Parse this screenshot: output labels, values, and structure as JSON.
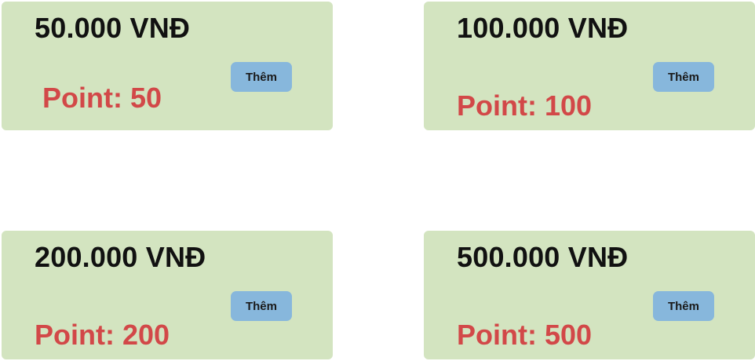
{
  "cards": [
    {
      "price": "50.000 VNĐ",
      "points": "Point: 50",
      "button_label": "Thêm"
    },
    {
      "price": "100.000 VNĐ",
      "points": "Point: 100",
      "button_label": "Thêm"
    },
    {
      "price": "200.000 VNĐ",
      "points": "Point: 200",
      "button_label": "Thêm"
    },
    {
      "price": "500.000 VNĐ",
      "points": "Point: 500",
      "button_label": "Thêm"
    }
  ],
  "colors": {
    "card_background": "#d3e4c0",
    "price_text": "#111111",
    "points_text": "#d24848",
    "button_background": "#87b7dc"
  }
}
